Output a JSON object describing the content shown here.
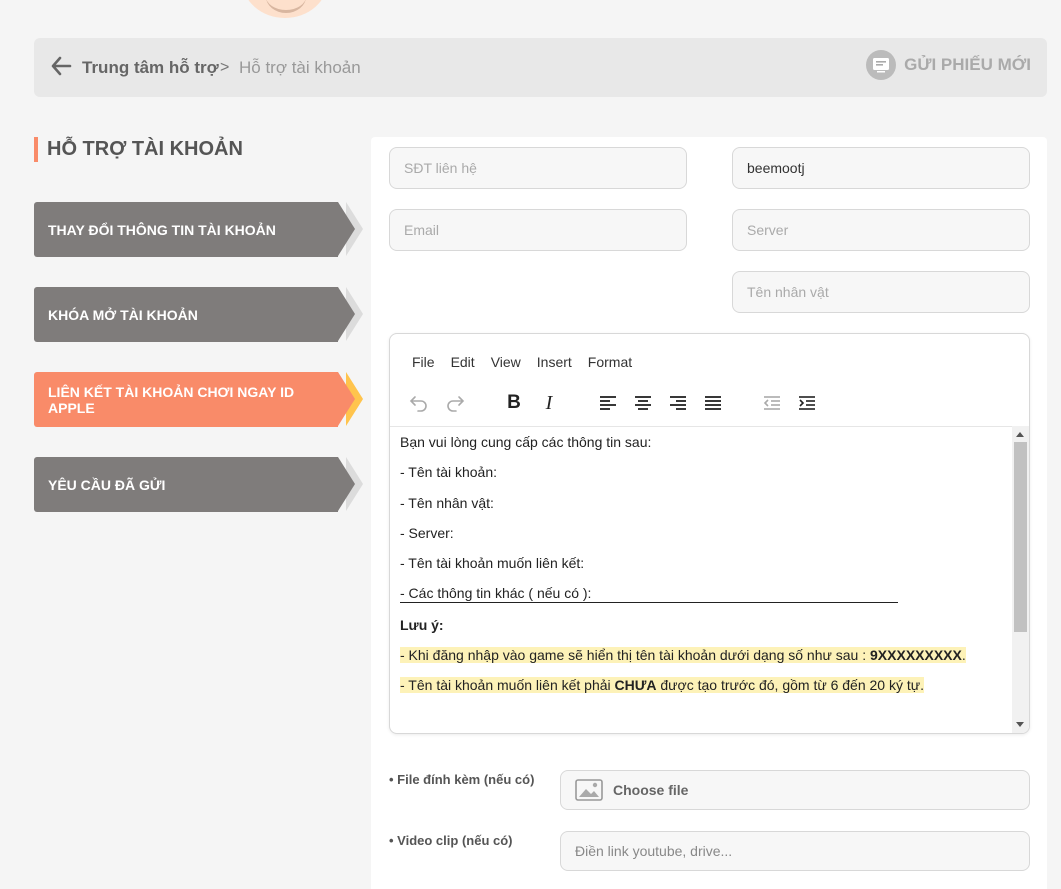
{
  "breadcrumb": {
    "root": "Trung tâm hỗ trợ",
    "separator": ">",
    "current": "Hỗ trợ tài khoản",
    "new_ticket": "GỬI PHIẾU MỚI"
  },
  "sidebar": {
    "title": "HỖ TRỢ TÀI KHOẢN",
    "items": [
      {
        "label": "THAY ĐỔI THÔNG TIN TÀI KHOẢN",
        "active": false
      },
      {
        "label": "KHÓA MỞ TÀI KHOẢN",
        "active": false
      },
      {
        "label": "LIÊN KẾT TÀI KHOẢN CHƠI NGAY ID APPLE",
        "active": true
      },
      {
        "label": "YÊU CẦU ĐÃ GỬI",
        "active": false
      }
    ]
  },
  "form": {
    "phone": {
      "placeholder": "SĐT liên hệ",
      "value": ""
    },
    "username": {
      "placeholder": "",
      "value": "beemootj"
    },
    "email": {
      "placeholder": "Email",
      "value": ""
    },
    "server": {
      "placeholder": "Server",
      "value": ""
    },
    "character": {
      "placeholder": "Tên nhân vật",
      "value": ""
    },
    "attachment_label": "• File đính kèm (nếu có)",
    "attachment_button": "Choose file",
    "video_label": "• Video clip (nếu có)",
    "video_placeholder": "Điền link youtube, drive..."
  },
  "editor": {
    "menu": [
      "File",
      "Edit",
      "View",
      "Insert",
      "Format"
    ],
    "lines": {
      "intro": "Bạn vui lòng cung cấp các thông tin sau:",
      "l1": "- Tên tài khoản:",
      "l2": "- Tên nhân vật:",
      "l3": "- Server:",
      "l4": "- Tên tài khoản muốn liên kết:",
      "l5": "- Các thông tin khác ( nếu có ):",
      "note_title": "Lưu ý:",
      "note1_pre": "- Khi đăng nhập vào game sẽ hiển thị tên tài khoản dưới dạng số như sau : ",
      "note1_bold": "9XXXXXXXXX",
      "note1_post": ".",
      "note2_pre": "- Tên tài khoản muốn liên kết phải ",
      "note2_bold": "CHƯA",
      "note2_post": " được tạo trước đó, gồm từ 6 đến 20 ký tự."
    }
  },
  "colors": {
    "accent": "#f98b69",
    "sidebar_item": "#7f7c7b",
    "highlight": "#fdf2b8",
    "active_tail": "#ffc44d"
  }
}
